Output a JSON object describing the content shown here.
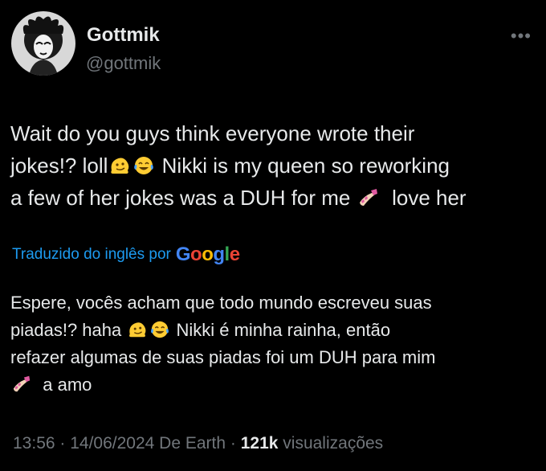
{
  "author": {
    "display_name": "Gottmik",
    "handle": "@gottmik",
    "avatar_icon": "avatar-drawing-icon"
  },
  "more_icon": "ellipsis-icon",
  "tweet": {
    "line1": "Wait do you guys think everyone wrote their",
    "line2_a": "jokes!? loll",
    "line2_b": "Nikki is my queen so reworking",
    "line3_a": "a few of her jokes was a DUH for me",
    "line3_b": "love her"
  },
  "translation_notice": {
    "label": "Traduzido do inglês por",
    "brand": [
      "G",
      "o",
      "o",
      "g",
      "l",
      "e"
    ],
    "brand_colors": [
      "#4285F4",
      "#EA4335",
      "#FBBC05",
      "#4285F4",
      "#34A853",
      "#EA4335"
    ]
  },
  "translation": {
    "line1": "Espere, vocês acham que todo mundo escreveu suas",
    "line2_a": "piadas!? haha",
    "line2_b": "Nikki é minha rainha, então",
    "line3": "refazer algumas de suas piadas foi um DUH para mim",
    "line4": "a amo"
  },
  "meta": {
    "timestamp": "13:56 · 14/06/2024 De Earth",
    "separator": "·",
    "views_count": "121k",
    "views_label": "visualizações"
  },
  "emojis": [
    "melting-face-emoji",
    "crying-laughing-emoji",
    "nail-polish-emoji"
  ]
}
